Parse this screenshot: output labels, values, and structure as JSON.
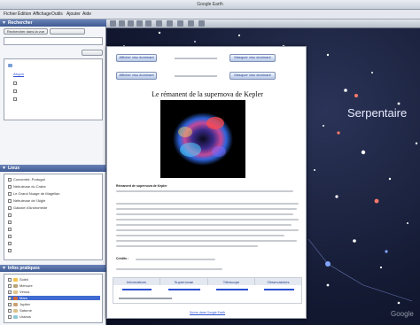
{
  "window": {
    "title": "Google Earth"
  },
  "menu": [
    "Fichier",
    "Édition",
    "Affichage",
    "Outils",
    "Ajouter",
    "Aide"
  ],
  "sidebar": {
    "search": {
      "header": "Rechercher",
      "tab_a": "Rechercher dans la vue"
    },
    "search_results": [
      {
        "label": "Alcyon"
      }
    ],
    "places": {
      "header": "Lieux"
    },
    "places_items": [
      {
        "label": "Concentré, Portugal"
      },
      {
        "label": "Nébuleuse du Crabe"
      },
      {
        "label": "Le Grand Nuage de Magellan"
      },
      {
        "label": "Nébuleuse de l'Aigle"
      },
      {
        "label": "Galaxie d'Andromède"
      }
    ],
    "layers": {
      "header": "Infos pratiques"
    },
    "layer_items": [
      {
        "label": "Soleil"
      },
      {
        "label": "Mercure"
      },
      {
        "label": "Vénus"
      },
      {
        "label": "Mars"
      },
      {
        "label": "Jupiter"
      },
      {
        "label": "Saturne"
      },
      {
        "label": "Uranus"
      },
      {
        "label": "Neptune"
      }
    ]
  },
  "map": {
    "constellation_label": "Serpentaire",
    "watermark": "Google"
  },
  "popup": {
    "btn_show_prev": "Afficher visu dominant",
    "btn_hide_prev": "Masquer visu dominant",
    "btn_show_next": "Afficher visu dominant",
    "btn_hide_next": "Masquer visu dominant",
    "title": "Le rémanent de la supernova de Kepler",
    "caption_bold": "Rémanent de supernova de Kepler",
    "credits_label": "Crédits :",
    "table_headers": [
      "Informations",
      "Supernovae",
      "Télescope",
      "Observatoires"
    ],
    "footer_link": "Suivre dans Google Earth"
  }
}
